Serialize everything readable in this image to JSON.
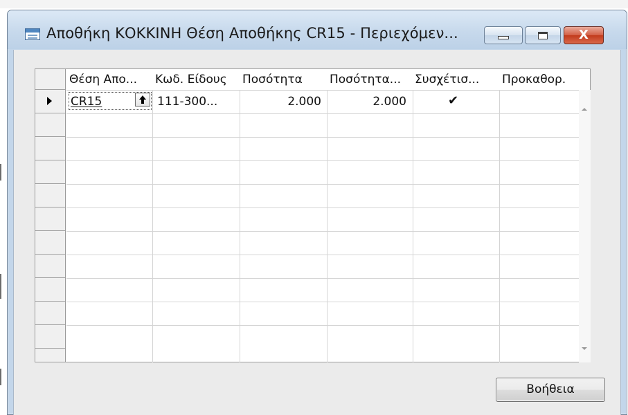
{
  "window": {
    "title": "Αποθήκη ΚΟΚΚΙΝΗ Θέση Αποθήκης CR15 - Περιεχόμεν...",
    "icon": "table-window-icon",
    "close_glyph": "X"
  },
  "table": {
    "columns": [
      "Θέση Απο...",
      "Κωδ. Είδους",
      "Ποσότητα",
      "Ποσότητα...",
      "Συσχέτισ...",
      "Προκαθορ."
    ],
    "rows": [
      {
        "bin_code": "CR15",
        "item_no": "111-300...",
        "quantity": "2.000",
        "quantity_base": "2.000",
        "fixed": "✔",
        "default": ""
      }
    ],
    "empty_rows": 10
  },
  "buttons": {
    "help": "Βοήθεια"
  },
  "colors": {
    "titlebar": "#c7d9ec",
    "close_button": "#c23a1c",
    "client": "#ebebeb"
  }
}
